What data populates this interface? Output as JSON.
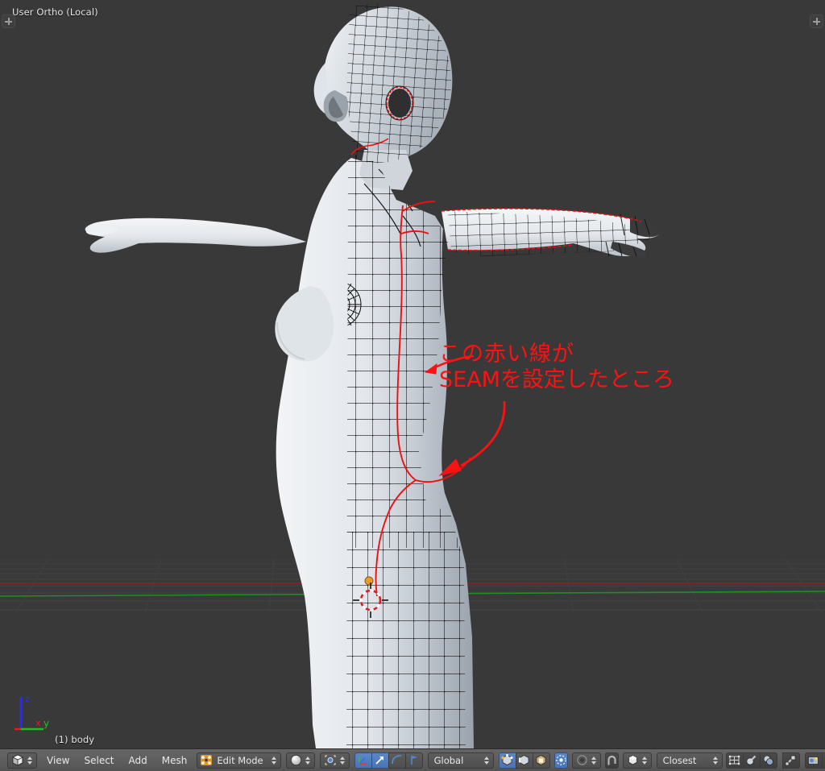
{
  "window": {
    "app": "Blender",
    "background_color": "#393939",
    "header_color": "#5e5e5e"
  },
  "viewport": {
    "view_name": "User Ortho (Local)",
    "object_name": "(1) body",
    "corner_toggle_icon": "plus-icon",
    "axis_gizmo": {
      "z_label": "z",
      "x_label": "x",
      "y_label": "y",
      "z_color": "#2b2bff",
      "x_color": "#e02020",
      "y_color": "#1fbf1f"
    },
    "grid": {
      "x_axis_color": "#9a2a2a",
      "y_axis_color": "#2a9a2a",
      "grid_color": "#4a4a4a"
    },
    "mesh": {
      "name": "body",
      "surface_color": "#c3c8cf",
      "wire_color": "#101010",
      "seam_color": "#ee1010",
      "selected_vert_color": "#eb9a2c"
    },
    "cursor_3d": {
      "name": "3d-cursor",
      "color_a": "#ffffff",
      "color_b": "#d02020"
    }
  },
  "annotation": {
    "color": "#ff1111",
    "line1": "この赤い線が",
    "line2": "SEAMを設定したところ"
  },
  "header": {
    "editor_type_label": "editor-type-3d-viewport",
    "menus": [
      "View",
      "Select",
      "Add",
      "Mesh"
    ],
    "mode": {
      "label": "Edit Mode",
      "icon": "edit-mode-icon"
    },
    "shading_ball": {
      "label": "",
      "icon": "viewport-shading-icon"
    },
    "pivot": {
      "icon": "pivot-point-icon"
    },
    "transform_gizmos": [
      {
        "icon": "move-gizmo-icon",
        "active": true
      },
      {
        "icon": "rotate-gizmo-icon",
        "active": false
      },
      {
        "icon": "scale-gizmo-icon",
        "active": false
      }
    ],
    "orientation": {
      "label": "Global"
    },
    "select_modes": [
      {
        "icon": "vertex-select-icon",
        "active": true
      },
      {
        "icon": "edge-select-icon",
        "active": false
      },
      {
        "icon": "face-select-icon",
        "active": false
      }
    ],
    "proportional_edit": {
      "icon": "proportional-edit-icon",
      "active": true
    },
    "proportional_falloff": {
      "icon": "smooth-falloff-icon"
    },
    "snap_magnet": {
      "icon": "snap-magnet-icon",
      "active": false
    },
    "snap_element": {
      "icon": "snap-element-icon"
    },
    "snap_target": {
      "label": "Closest"
    },
    "right_tools": [
      {
        "icon": "mesh-display-icon"
      },
      {
        "icon": "uv-sculpt-icon"
      },
      {
        "icon": "occlude-geometry-icon"
      },
      {
        "icon": "pose-copy-icon"
      },
      {
        "icon": "render-image-icon"
      },
      {
        "icon": "render-animation-icon"
      }
    ]
  }
}
